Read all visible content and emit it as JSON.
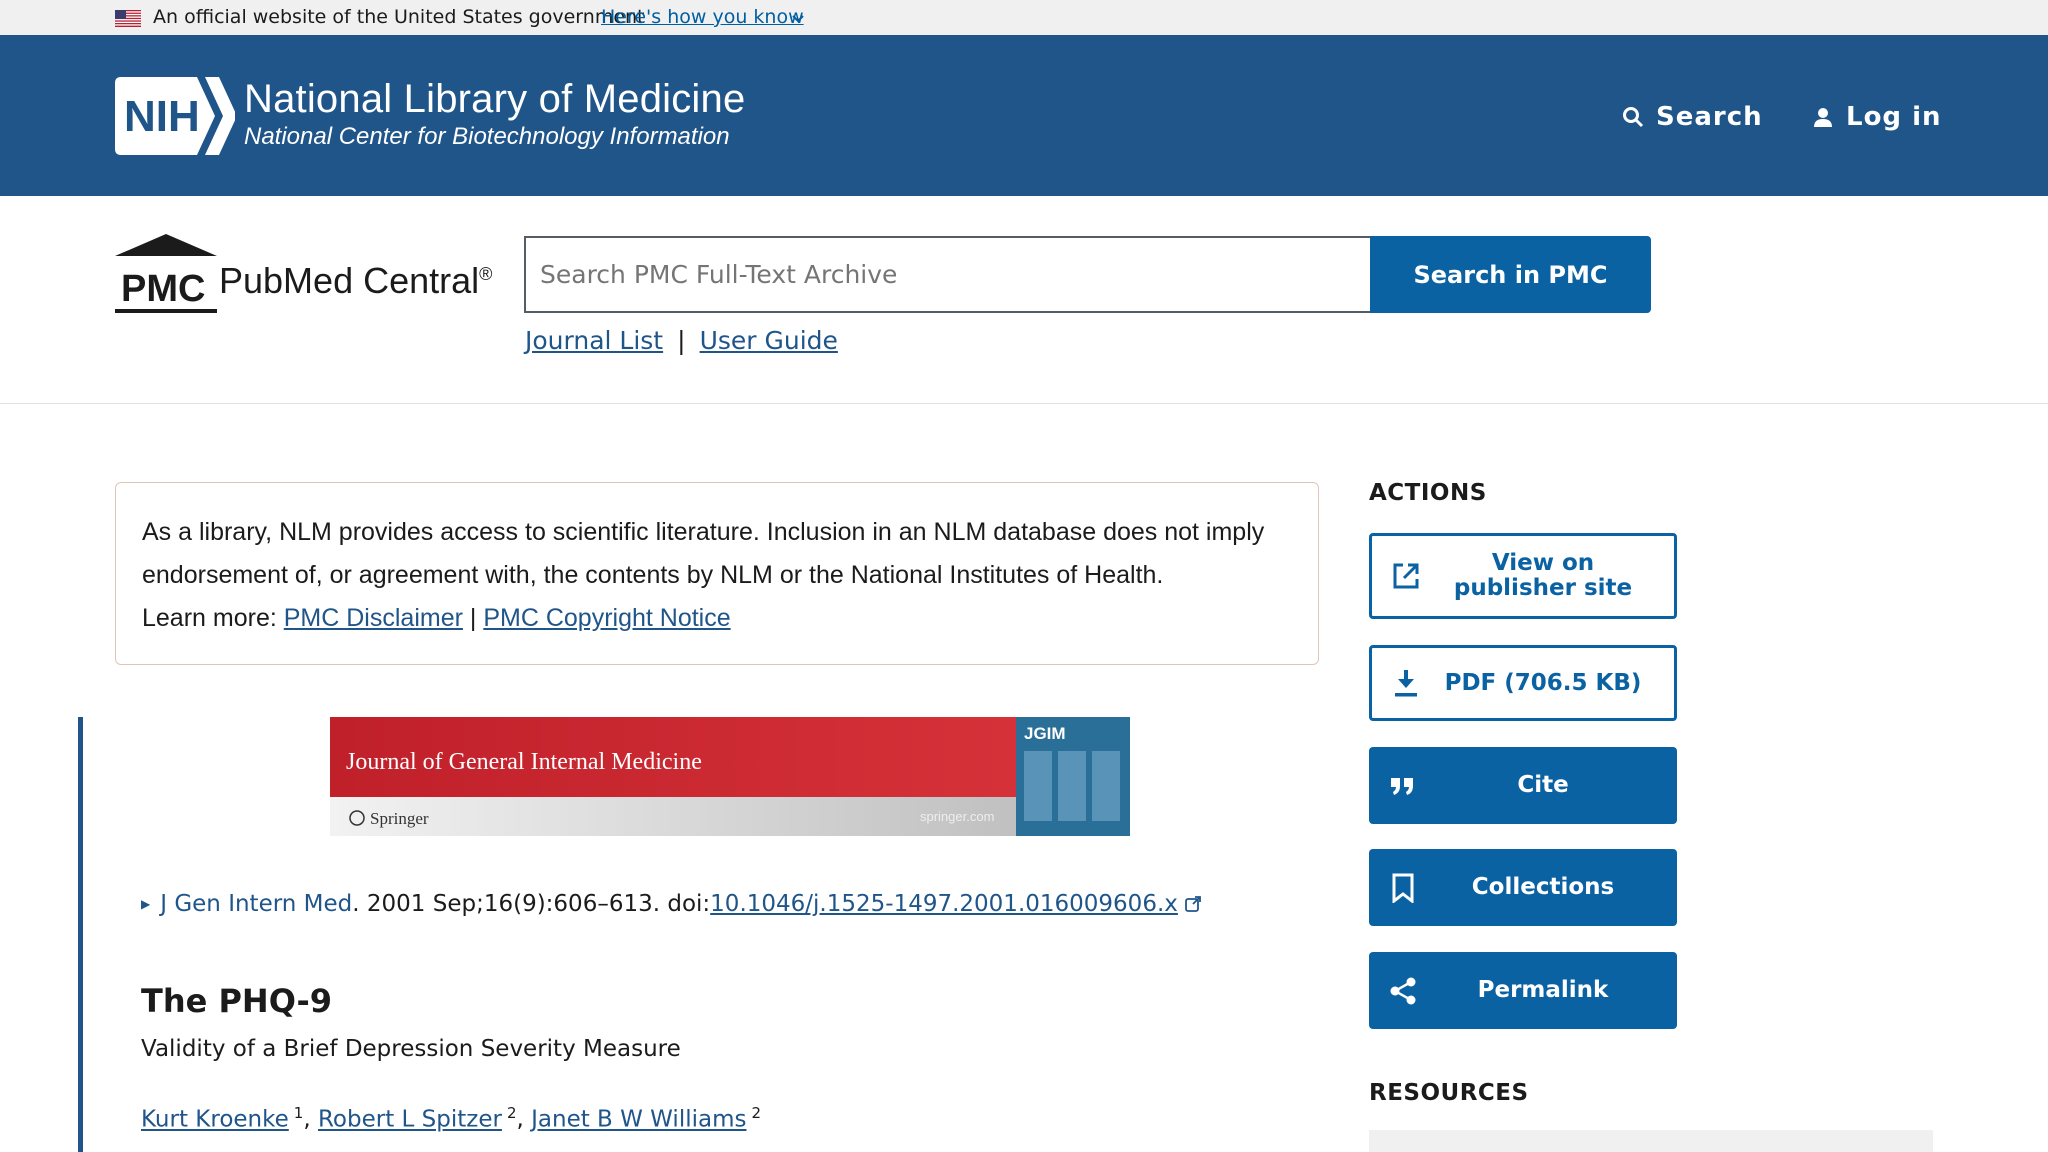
{
  "gov_banner": {
    "text": "An official website of the United States government",
    "link": "Here's how you know"
  },
  "nih_header": {
    "logo_text": "NIH",
    "title": "National Library of Medicine",
    "subtitle": "National Center for Biotechnology Information",
    "search_label": "Search",
    "login_label": "Log in"
  },
  "pmc": {
    "logo_short": "PMC",
    "logo_name": "PubMed Central",
    "logo_reg": "®",
    "search_placeholder": "Search PMC Full-Text Archive",
    "search_button": "Search in PMC",
    "journal_list": "Journal List",
    "user_guide": "User Guide",
    "separator": "|"
  },
  "disclaimer": {
    "line1": "As a library, NLM provides access to scientific literature. Inclusion in an NLM database does not imply",
    "line2": "endorsement of, or agreement with, the contents by NLM or the National Institutes of Health.",
    "learn_more": "Learn more: ",
    "link1": "PMC Disclaimer",
    "sep": " | ",
    "link2": "PMC Copyright Notice"
  },
  "journal_banner": {
    "title": "Journal of General Internal Medicine",
    "publisher": "Springer",
    "site": "springer.com",
    "cover_label": "JGIM"
  },
  "citation": {
    "journal": "J Gen Intern Med",
    "details": ". 2001 Sep;16(9):606–613. doi: ",
    "doi": "10.1046/j.1525-1497.2001.016009606.x"
  },
  "article": {
    "title": "The PHQ-9",
    "subtitle": "Validity of a Brief Depression Severity Measure",
    "authors": [
      {
        "name": "Kurt Kroenke",
        "sup": "1"
      },
      {
        "name": "Robert L Spitzer",
        "sup": "2"
      },
      {
        "name": "Janet B W Williams",
        "sup": "2"
      }
    ]
  },
  "sidebar": {
    "actions_heading": "ACTIONS",
    "view_publisher_1": "View on",
    "view_publisher_2": "publisher site",
    "pdf": "PDF (706.5 KB)",
    "cite": "Cite",
    "collections": "Collections",
    "permalink": "Permalink",
    "resources_heading": "RESOURCES"
  },
  "colors": {
    "nih_blue": "#20558a",
    "action_blue": "#0b62a3",
    "link_blue": "#005ea2",
    "banner_gray": "#f0f0f0"
  }
}
